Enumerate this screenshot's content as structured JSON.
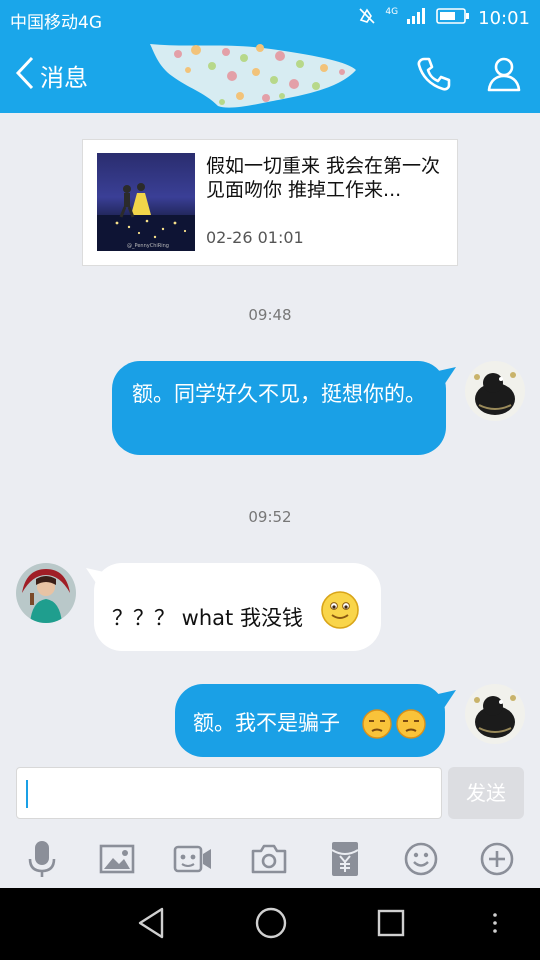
{
  "status_bar": {
    "carrier": "中国移动4G",
    "network": "4G",
    "time": "10:01"
  },
  "header": {
    "back_label": "消息",
    "icons": [
      "back-chevron-icon",
      "phone-icon",
      "profile-icon"
    ]
  },
  "shared_card": {
    "title": "假如一切重来 我会在第一次见面吻你 推掉工作来...",
    "date": "02-26 01:01",
    "thumb_caption": "@_PennyChiRing"
  },
  "messages": [
    {
      "type": "timestamp",
      "text": "09:48"
    },
    {
      "type": "outgoing",
      "text": "额。同学好久不见，挺想你的。"
    },
    {
      "type": "timestamp",
      "text": "09:52"
    },
    {
      "type": "incoming",
      "text": "？？？ what 我没钱",
      "emoji": "smile-emoji"
    },
    {
      "type": "outgoing",
      "text": "额。我不是骗子",
      "emoji": "unamused-emoji"
    }
  ],
  "composer": {
    "placeholder": "",
    "send_label": "发送"
  },
  "toolbar": [
    "microphone-icon",
    "image-icon",
    "video-icon",
    "camera-icon",
    "red-packet-icon",
    "emoji-icon",
    "plus-icon"
  ],
  "colors": {
    "accent": "#1aa6ea",
    "outgoing_bubble": "#1aa0e6",
    "background": "#ebedf2"
  }
}
